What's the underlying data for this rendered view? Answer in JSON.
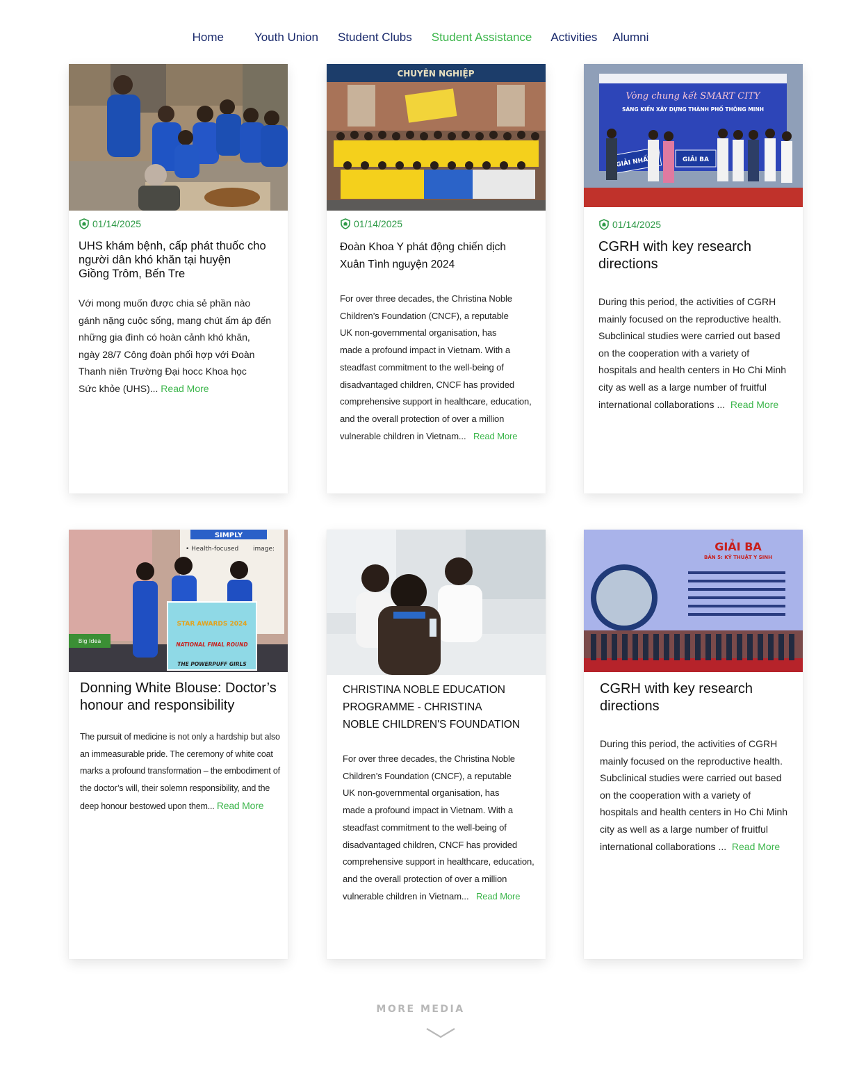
{
  "nav": {
    "items": [
      {
        "label": "Home"
      },
      {
        "label": "Youth Union"
      },
      {
        "label": "Student Clubs"
      },
      {
        "label": "Student Assistance"
      },
      {
        "label": "Activities"
      },
      {
        "label": "Alumni"
      }
    ],
    "active_color": "#3bb54a",
    "default_color": "#1a2a6c"
  },
  "cards": [
    {
      "date": "01/14/2025",
      "title_lines": [
        "UHS khám bệnh, cấp phát thuốc cho",
        "người dân khó khăn tại huyện",
        "Giồng Trôm, Bến Tre"
      ],
      "excerpt_lines": [
        "Với mong muốn được chia sẻ phần nào",
        "gánh nặng cuộc sống, mang chút ấm áp đến",
        "những gia đình có hoàn cảnh khó khăn,",
        "ngày 28/7 Công đoàn phối hợp với Đoàn",
        "Thanh niên Trường Đại hocc Khoa học",
        "Sức khỏe (UHS)... "
      ],
      "read_more": "Read More"
    },
    {
      "date": "01/14/2025",
      "title_lines": [
        "Đoàn Khoa Y phát động chiến dịch",
        "Xuân Tình nguyện 2024"
      ],
      "photo_banner": "CHUYÊN NGHIỆP",
      "excerpt_lines": [
        "For over three decades, the Christina Noble",
        "Children’s Foundation (CNCF), a reputable",
        "UK non-governmental organisation, has",
        "made a profound impact in Vietnam. With a",
        "steadfast commitment to the well-being of",
        "disadvantaged children, CNCF has provided",
        "comprehensive support in healthcare, education,",
        "and the overall protection of over a million",
        "vulnerable children in Vietnam...   "
      ],
      "read_more": "Read More"
    },
    {
      "date": "01/14/2025",
      "title_lines": [
        "CGRH with key research",
        "directions"
      ],
      "photo_banner": "Vòng chung kết  SMART CITY",
      "photo_sub": "SÁNG KIẾN XÂY DỰNG THÀNH PHỐ THÔNG MINH",
      "photo_sign1": "GIẢI NHẤT",
      "photo_sign2": "GIẢI BA",
      "excerpt_lines": [
        "During this period, the activities of CGRH",
        "mainly focused on the reproductive health.",
        "Subclinical studies were carried out based",
        "on the cooperation with a variety of",
        "hospitals and health centers in Ho Chi Minh",
        "city as well as a large number of fruitful",
        "international collaborations ...  "
      ],
      "read_more": "Read More"
    },
    {
      "title_lines": [
        "Donning White Blouse: Doctor’s",
        "honour and responsibility"
      ],
      "photo_top": "SIMPLY",
      "photo_bullet": "• Health-focused",
      "photo_image": "image:",
      "photo_sign1": "STAR AWARDS 2024",
      "photo_sign2": "NATIONAL FINAL ROUND",
      "photo_caption": "THE POWERPUFF GIRLS",
      "photo_idea": "Big Idea",
      "excerpt_lines": [
        "The pursuit of medicine is not only a hardship but also",
        "an immeasurable pride. The ceremony of white coat",
        "marks a profound transformation – the embodiment of",
        "the doctor’s will, their solemn responsibility, and the",
        "deep honour bestowed upon them... "
      ],
      "read_more": "Read More"
    },
    {
      "title_lines": [
        "CHRISTINA NOBLE EDUCATION",
        "PROGRAMME - CHRISTINA",
        "NOBLE CHILDREN'S FOUNDATION"
      ],
      "excerpt_lines": [
        "For over three decades, the Christina Noble",
        "Children’s Foundation (CNCF), a reputable",
        "UK non-governmental organisation, has",
        "made a profound impact in Vietnam. With a",
        "steadfast commitment to the well-being of",
        "disadvantaged children, CNCF has provided",
        "comprehensive support in healthcare, education,",
        "and the overall protection of over a million",
        "vulnerable children in Vietnam...   "
      ],
      "read_more": "Read More"
    },
    {
      "title_lines": [
        "CGRH with key research",
        "directions"
      ],
      "photo_banner": "GIẢI BA",
      "photo_sub": "BẢN 5: KỸ THUẬT Y SINH",
      "excerpt_lines": [
        "During this period, the activities of CGRH",
        "mainly focused on the reproductive health.",
        "Subclinical studies were carried out based",
        "on the cooperation with a variety of",
        "hospitals and health centers in Ho Chi Minh",
        "city as well as a large number of fruitful",
        "international collaborations ...  "
      ],
      "read_more": "Read More"
    }
  ],
  "footer": {
    "more_label": "MORE MEDIA"
  },
  "colors": {
    "accent": "#3bb54a",
    "nav_text": "#1a2a6c",
    "date_green": "#2e9a47"
  },
  "icons": {
    "date_icon": "shield-badge-icon",
    "chevron": "chevron-down-icon"
  }
}
